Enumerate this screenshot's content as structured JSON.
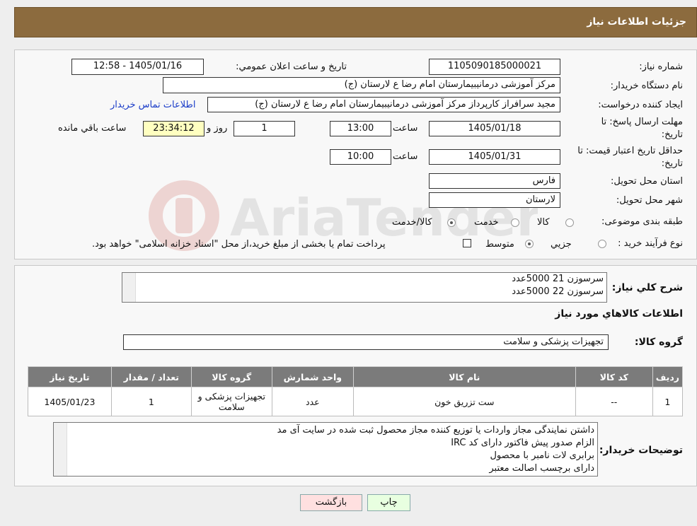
{
  "header": {
    "title": "جزئیات اطلاعات نیاز"
  },
  "form": {
    "need_number_label": "شماره نیاز:",
    "need_number": "1105090185000021",
    "announce_label": "تاریخ و ساعت اعلان عمومي:",
    "announce_value": "1405/01/16 - 12:58",
    "buyer_org_label": "نام دستگاه خريدار:",
    "buyer_org": "مرکز آموزشی درمانیبیمارستان امام رضا  ع  لارستان (ج)",
    "requester_label": "ايجاد کننده درخواست:",
    "requester": "مجید سرافراز کارپرداز  مرکز آموزشی درمانیبیمارستان امام رضا  ع  لارستان (ج)",
    "contact_link": "اطلاعات تماس خريدار",
    "deadline_label_1": "مهلت ارسال پاسخ: تا",
    "deadline_label_2": "تاريخ:",
    "deadline_date": "1405/01/18",
    "time_label": "ساعت",
    "deadline_time": "13:00",
    "days_value": "1",
    "days_label": "روز و",
    "remaining_time": "23:34:12",
    "remaining_label": "ساعت باقي مانده",
    "price_valid_label_1": "حداقل تاريخ اعتبار قيمت: تا",
    "price_valid_label_2": "تاريخ:",
    "price_valid_date": "1405/01/31",
    "price_valid_time": "10:00",
    "province_label": "استان محل تحويل:",
    "province": "فارس",
    "city_label": "شهر محل تحويل:",
    "city": "لارستان",
    "category_label": "طبقه بندی موضوعی:",
    "category_options": [
      "کالا",
      "خدمت",
      "کالا/خدمت"
    ],
    "process_label": "نوع فرآيند خريد :",
    "process_options": [
      "جزیي",
      "متوسط"
    ],
    "process_note": "پرداخت تمام يا بخشی از مبلغ خريد،از محل \"اسناد خزانه اسلامی\" خواهد بود."
  },
  "summary": {
    "label": "شرح کلي نياز:",
    "lines": [
      "سرسوزن 21        5000عدد",
      "سرسوزن 22        5000عدد"
    ]
  },
  "goods": {
    "section_title": "اطلاعات کالاهاي مورد نياز",
    "group_label": "گروه کالا:",
    "group_value": "تجهیزات پزشکی و سلامت",
    "columns": [
      "رديف",
      "کد کالا",
      "نام کالا",
      "واحد شمارش",
      "گروه کالا",
      "تعداد / مقدار",
      "تاريخ نياز"
    ],
    "row": [
      "1",
      "--",
      "ست تزریق خون",
      "عدد",
      "تجهیزات پزشکی و سلامت",
      "1",
      "1405/01/23"
    ]
  },
  "notes": {
    "label": "توضيحات خريدار:",
    "lines": [
      "داشتن نمایندگی مجاز واردات یا توزیع کننده مجاز محصول ثبت شده در سایت آی مد",
      "الزام صدور پیش فاکتور دارای کد IRC",
      "برابری لات نامبر با محصول",
      "دارای برچسب اصالت معتبر"
    ]
  },
  "buttons": {
    "print": "چاپ",
    "back": "بازگشت"
  },
  "watermark": {
    "text": "AriaTender.neT"
  },
  "colors": {
    "header": "#8c6b3e",
    "table_header": "#7b7b7b",
    "link": "#1a3cc8"
  }
}
